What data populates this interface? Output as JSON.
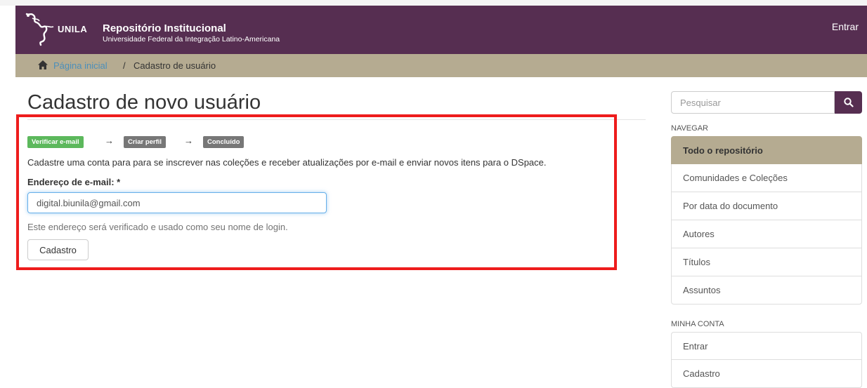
{
  "header": {
    "logo_text": "UNILA",
    "site_title": "Repositório Institucional",
    "site_subtitle": "Universidade Federal da Integração Latino-Americana",
    "login_link": "Entrar",
    "brand_color": "#562e51"
  },
  "breadcrumb": {
    "home_icon": "home-icon",
    "home_label": "Página inicial",
    "separator": "/",
    "current": "Cadastro de usuário",
    "bar_color": "#b5ab91"
  },
  "main": {
    "title": "Cadastro de novo usuário",
    "steps": [
      {
        "label": "Verificar e-mail",
        "status": "active",
        "color": "#5cb85c"
      },
      {
        "label": "Criar perfil",
        "status": "pending",
        "color": "#777777"
      },
      {
        "label": "Concluído",
        "status": "pending",
        "color": "#777777"
      }
    ],
    "step_arrow": "→",
    "intro": "Cadastre uma conta para para se inscrever nas coleções e receber atualizações por e-mail e enviar novos itens para o DSpace.",
    "email_label": "Endereço de e-mail: *",
    "email_value": "digital.biunila@gmail.com",
    "help_text": "Este endereço será verificado e usado como seu nome de login.",
    "submit_label": "Cadastro",
    "highlight_color": "#ee1c1c"
  },
  "sidebar": {
    "search": {
      "placeholder": "Pesquisar",
      "icon": "search-icon"
    },
    "nav_heading": "NAVEGAR",
    "nav_items": [
      {
        "label": "Todo o repositório",
        "active": true
      },
      {
        "label": "Comunidades e Coleções",
        "active": false
      },
      {
        "label": "Por data do documento",
        "active": false
      },
      {
        "label": "Autores",
        "active": false
      },
      {
        "label": "Títulos",
        "active": false
      },
      {
        "label": "Assuntos",
        "active": false
      }
    ],
    "account_heading": "MINHA CONTA",
    "account_items": [
      {
        "label": "Entrar"
      },
      {
        "label": "Cadastro"
      }
    ]
  }
}
